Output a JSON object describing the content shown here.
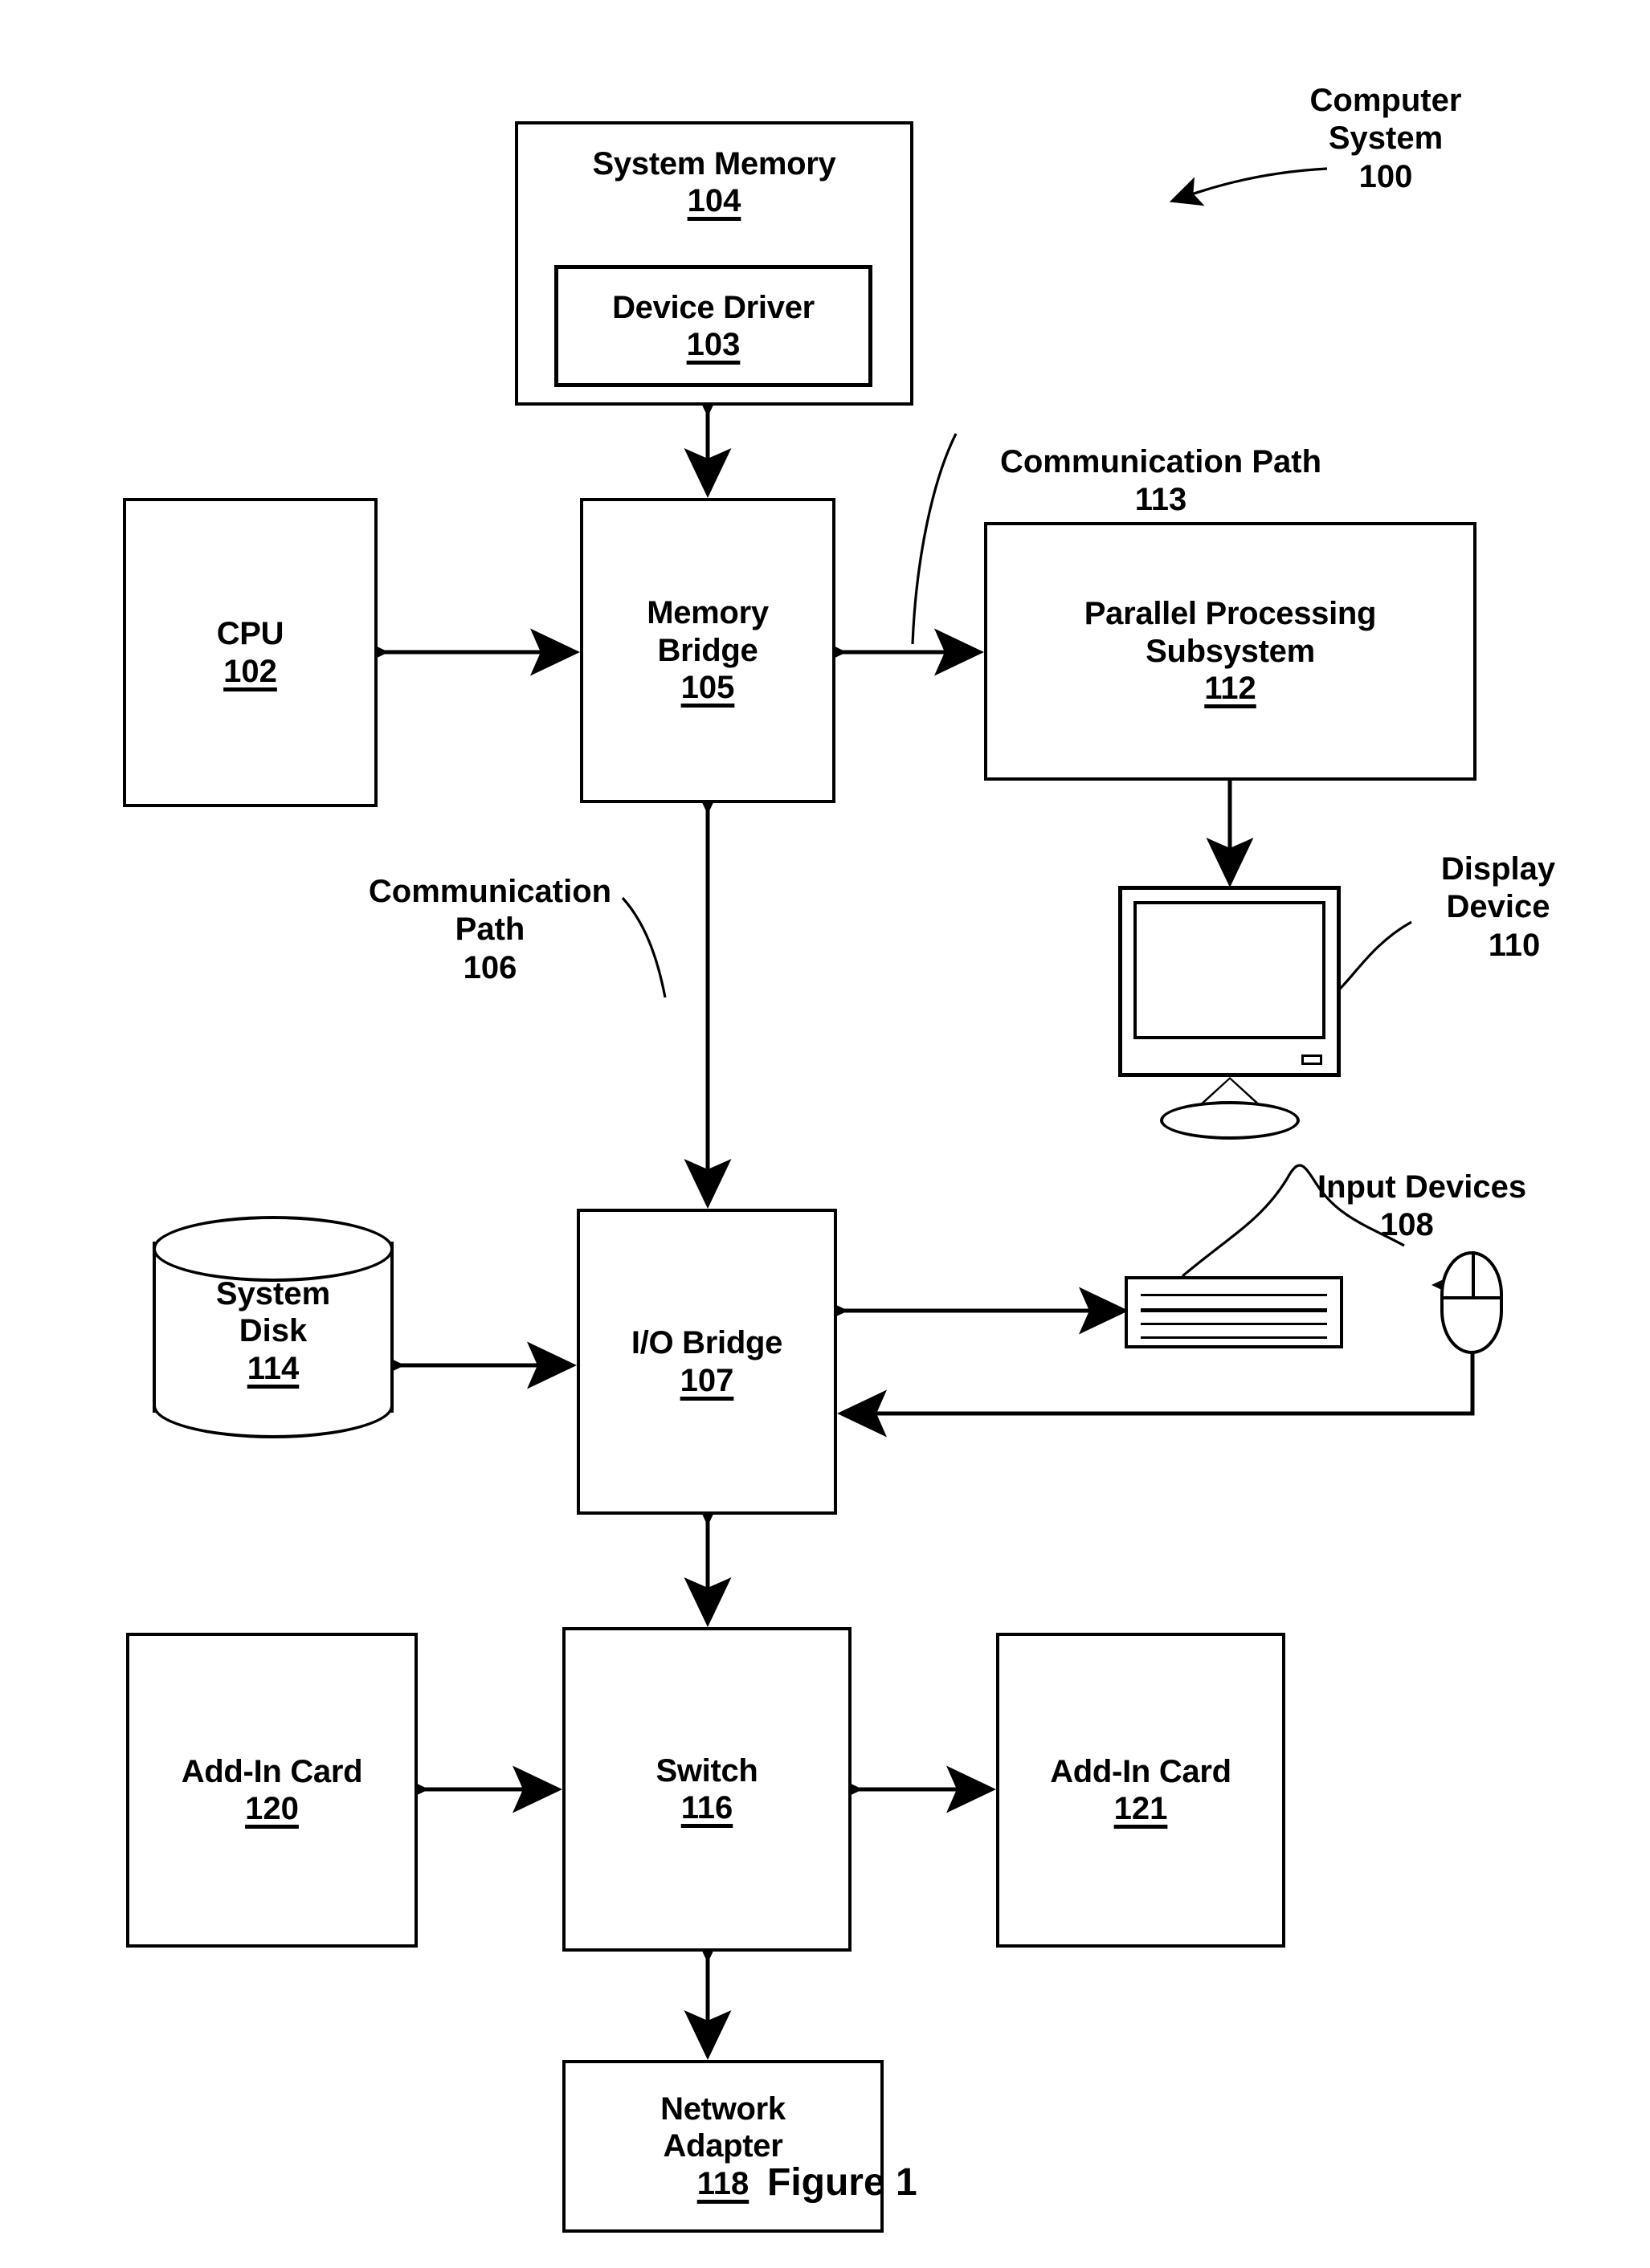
{
  "figure": {
    "caption": "Figure 1",
    "system_label": {
      "title": "Computer\nSystem",
      "number": "100"
    }
  },
  "blocks": {
    "system_memory": {
      "title": "System Memory",
      "number": "104"
    },
    "device_driver": {
      "title": "Device Driver",
      "number": "103"
    },
    "cpu": {
      "title": "CPU",
      "number": "102"
    },
    "memory_bridge": {
      "title": "Memory\nBridge",
      "number": "105"
    },
    "parallel_processing_subsystem": {
      "title": "Parallel Processing\nSubsystem",
      "number": "112"
    },
    "io_bridge": {
      "title": "I/O Bridge",
      "number": "107"
    },
    "system_disk": {
      "title": "System\nDisk",
      "number": "114"
    },
    "switch": {
      "title": "Switch",
      "number": "116"
    },
    "add_in_card_120": {
      "title": "Add-In Card",
      "number": "120"
    },
    "add_in_card_121": {
      "title": "Add-In Card",
      "number": "121"
    },
    "network_adapter": {
      "title": "Network\nAdapter",
      "number": "118"
    }
  },
  "callouts": {
    "communication_path_113": {
      "title": "Communication Path",
      "number": "113"
    },
    "communication_path_106": {
      "title": "Communication\nPath",
      "number": "106"
    },
    "display_device": {
      "title": "Display\nDevice",
      "number": "110"
    },
    "input_devices": {
      "title": "Input Devices",
      "number": "108"
    }
  },
  "colors": {
    "ink": "#000000",
    "paper": "#ffffff"
  }
}
